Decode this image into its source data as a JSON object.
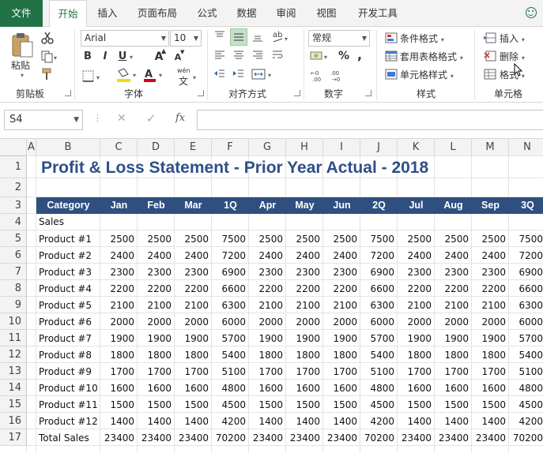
{
  "tabs": [
    "文件",
    "开始",
    "插入",
    "页面布局",
    "公式",
    "数据",
    "审阅",
    "视图",
    "开发工具"
  ],
  "active_tab": "开始",
  "ribbon": {
    "clipboard": {
      "paste": "粘贴",
      "group": "剪贴板"
    },
    "font": {
      "name": "Arial",
      "size": "10",
      "bold": "B",
      "italic": "I",
      "underline": "U",
      "grow": "A",
      "shrink": "A",
      "wen": "wén",
      "wen_char": "文",
      "group": "字体"
    },
    "alignment": {
      "group": "对齐方式"
    },
    "number": {
      "format": "常规",
      "percent": "%",
      "comma": ",",
      "group": "数字"
    },
    "styles": {
      "conditional": "条件格式",
      "table": "套用表格格式",
      "cell_styles": "单元格样式",
      "group": "样式"
    },
    "cells": {
      "insert": "插入",
      "delete": "删除",
      "format": "格式",
      "group": "单元格"
    }
  },
  "formula_bar": {
    "name_box": "S4",
    "fx": "fx",
    "content": ""
  },
  "sheet": {
    "columns": [
      "A",
      "B",
      "C",
      "D",
      "E",
      "F",
      "G",
      "H",
      "I",
      "J",
      "K",
      "L",
      "M",
      "N"
    ],
    "rows": [
      "1",
      "2",
      "3",
      "4",
      "5",
      "6",
      "7",
      "8",
      "9",
      "10",
      "11",
      "12",
      "13",
      "14",
      "15",
      "16",
      "17"
    ],
    "title": "Profit & Loss Statement - Prior Year Actual - 2018",
    "header": [
      "Category",
      "Jan",
      "Feb",
      "Mar",
      "1Q",
      "Apr",
      "May",
      "Jun",
      "2Q",
      "Jul",
      "Aug",
      "Sep",
      "3Q"
    ],
    "section_label": "Sales",
    "data": [
      [
        "Product #1",
        "2500",
        "2500",
        "2500",
        "7500",
        "2500",
        "2500",
        "2500",
        "7500",
        "2500",
        "2500",
        "2500",
        "7500"
      ],
      [
        "Product #2",
        "2400",
        "2400",
        "2400",
        "7200",
        "2400",
        "2400",
        "2400",
        "7200",
        "2400",
        "2400",
        "2400",
        "7200"
      ],
      [
        "Product #3",
        "2300",
        "2300",
        "2300",
        "6900",
        "2300",
        "2300",
        "2300",
        "6900",
        "2300",
        "2300",
        "2300",
        "6900"
      ],
      [
        "Product #4",
        "2200",
        "2200",
        "2200",
        "6600",
        "2200",
        "2200",
        "2200",
        "6600",
        "2200",
        "2200",
        "2200",
        "6600"
      ],
      [
        "Product #5",
        "2100",
        "2100",
        "2100",
        "6300",
        "2100",
        "2100",
        "2100",
        "6300",
        "2100",
        "2100",
        "2100",
        "6300"
      ],
      [
        "Product #6",
        "2000",
        "2000",
        "2000",
        "6000",
        "2000",
        "2000",
        "2000",
        "6000",
        "2000",
        "2000",
        "2000",
        "6000"
      ],
      [
        "Product #7",
        "1900",
        "1900",
        "1900",
        "5700",
        "1900",
        "1900",
        "1900",
        "5700",
        "1900",
        "1900",
        "1900",
        "5700"
      ],
      [
        "Product #8",
        "1800",
        "1800",
        "1800",
        "5400",
        "1800",
        "1800",
        "1800",
        "5400",
        "1800",
        "1800",
        "1800",
        "5400"
      ],
      [
        "Product #9",
        "1700",
        "1700",
        "1700",
        "5100",
        "1700",
        "1700",
        "1700",
        "5100",
        "1700",
        "1700",
        "1700",
        "5100"
      ],
      [
        "Product #10",
        "1600",
        "1600",
        "1600",
        "4800",
        "1600",
        "1600",
        "1600",
        "4800",
        "1600",
        "1600",
        "1600",
        "4800"
      ],
      [
        "Product #11",
        "1500",
        "1500",
        "1500",
        "4500",
        "1500",
        "1500",
        "1500",
        "4500",
        "1500",
        "1500",
        "1500",
        "4500"
      ],
      [
        "Product #12",
        "1400",
        "1400",
        "1400",
        "4200",
        "1400",
        "1400",
        "1400",
        "4200",
        "1400",
        "1400",
        "1400",
        "4200"
      ],
      [
        "Total Sales",
        "23400",
        "23400",
        "23400",
        "70200",
        "23400",
        "23400",
        "23400",
        "70200",
        "23400",
        "23400",
        "23400",
        "70200"
      ]
    ]
  },
  "colors": {
    "accent": "#217346",
    "title": "#2f4f8a",
    "header_band": "#2f4f7f"
  }
}
